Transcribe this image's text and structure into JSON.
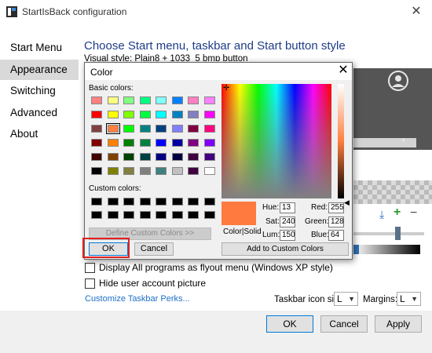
{
  "window": {
    "title": "StartIsBack configuration",
    "close_glyph": "✕"
  },
  "sidebar": {
    "items": [
      {
        "label": "Start Menu",
        "active": false
      },
      {
        "label": "Appearance",
        "active": true
      },
      {
        "label": "Switching",
        "active": false
      },
      {
        "label": "Advanced",
        "active": false
      },
      {
        "label": "About",
        "active": false
      }
    ]
  },
  "content": {
    "heading": "Choose Start menu, taskbar and Start button style",
    "visual_style": "Visual style: Plain8 + 1033_5 bmp button",
    "options": {
      "flyout": "Display All programs as flyout menu (Windows XP style)",
      "hide_picture": "Hide user account picture"
    },
    "perks_link": "Customize Taskbar Perks...",
    "icon_size_label": "Taskbar icon size:",
    "icon_size_value": "L",
    "margins_label": "Margins:",
    "margins_value": "L"
  },
  "footer": {
    "ok": "OK",
    "cancel": "Cancel",
    "apply": "Apply"
  },
  "color_dialog": {
    "title": "Color",
    "close_glyph": "✕",
    "basic_colors_label": "Basic colors:",
    "custom_colors_label": "Custom colors:",
    "define_custom": "Define Custom Colors >>",
    "basic_colors": [
      [
        "#ff8080",
        "#ffff80",
        "#80ff80",
        "#00ff80",
        "#80ffff",
        "#0080ff",
        "#ff80c0",
        "#ff80ff"
      ],
      [
        "#ff0000",
        "#ffff00",
        "#80ff00",
        "#00ff40",
        "#00ffff",
        "#0080c0",
        "#8080c0",
        "#ff00ff"
      ],
      [
        "#804040",
        "#ff8040",
        "#00ff00",
        "#008080",
        "#004080",
        "#8080ff",
        "#800040",
        "#ff0080"
      ],
      [
        "#800000",
        "#ff8000",
        "#008000",
        "#008040",
        "#0000ff",
        "#0000a0",
        "#800080",
        "#8000ff"
      ],
      [
        "#400000",
        "#804000",
        "#004000",
        "#004040",
        "#000080",
        "#000040",
        "#400040",
        "#400080"
      ],
      [
        "#000000",
        "#808000",
        "#808040",
        "#808080",
        "#408080",
        "#c0c0c0",
        "#400040",
        "#ffffff"
      ]
    ],
    "selected_swatch": "#ff8040",
    "color_solid_label": "Color|Solid",
    "fields": {
      "hue_label": "Hue:",
      "hue": "13",
      "sat_label": "Sat:",
      "sat": "240",
      "lum_label": "Lum:",
      "lum": "150",
      "red_label": "Red:",
      "red": "255",
      "green_label": "Green:",
      "green": "128",
      "blue_label": "Blue:",
      "blue": "64"
    },
    "add_custom": "Add to Custom Colors",
    "ok": "OK",
    "cancel": "Cancel"
  },
  "colors": {
    "accent": "#1e3c87",
    "link": "#1e6fc9",
    "highlight": "#e02020",
    "preview": "#ff7a3e"
  }
}
